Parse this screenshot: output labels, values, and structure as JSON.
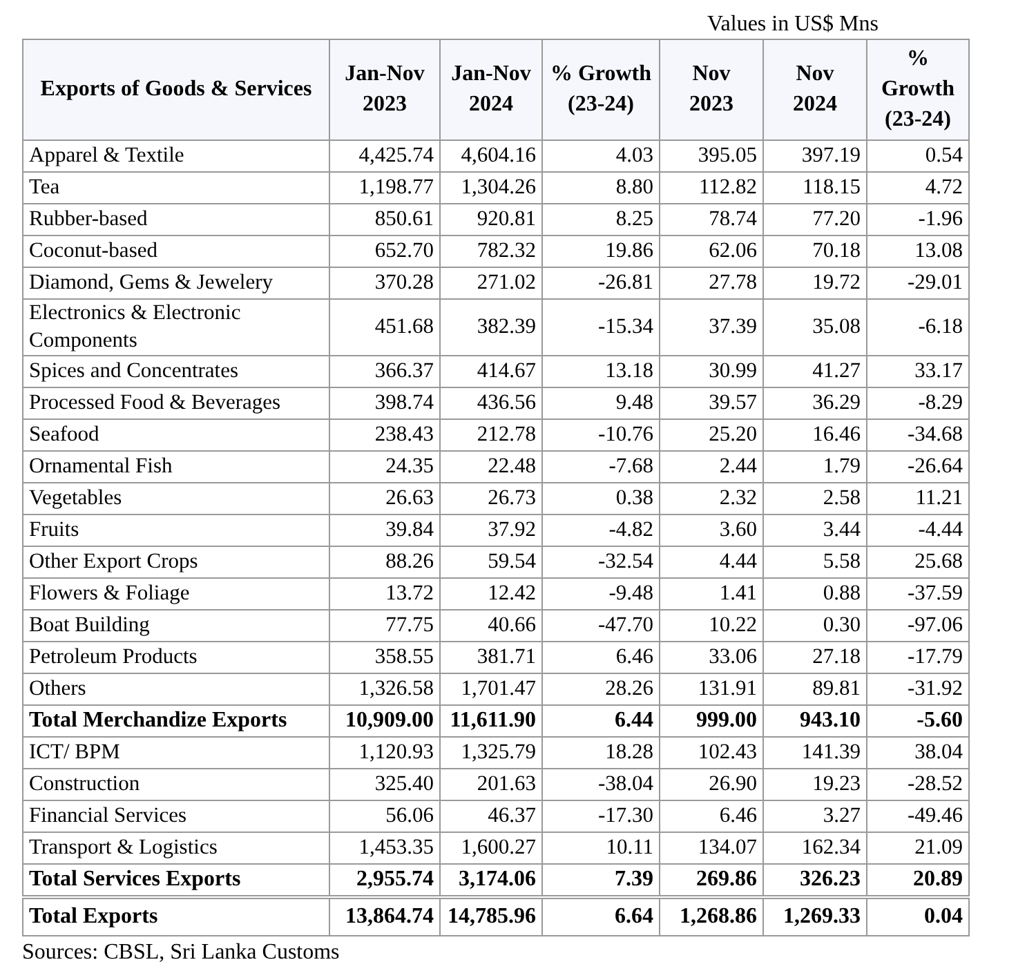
{
  "units_note": "Values in US$ Mns",
  "table": {
    "columns": [
      {
        "label": "Exports of Goods & Services"
      },
      {
        "label": "Jan-Nov\n2023"
      },
      {
        "label": "Jan-Nov\n2024"
      },
      {
        "label": "% Growth\n(23-24)"
      },
      {
        "label": "Nov\n2023"
      },
      {
        "label": "Nov\n2024"
      },
      {
        "label": "% Growth\n(23-24)"
      }
    ],
    "rows": [
      {
        "kind": "item",
        "cells": [
          "Apparel & Textile",
          "4,425.74",
          "4,604.16",
          "4.03",
          "395.05",
          "397.19",
          "0.54"
        ]
      },
      {
        "kind": "item",
        "cells": [
          "Tea",
          "1,198.77",
          "1,304.26",
          "8.80",
          "112.82",
          "118.15",
          "4.72"
        ]
      },
      {
        "kind": "item",
        "cells": [
          "Rubber-based",
          "850.61",
          "920.81",
          "8.25",
          "78.74",
          "77.20",
          "-1.96"
        ]
      },
      {
        "kind": "item",
        "cells": [
          "Coconut-based",
          "652.70",
          "782.32",
          "19.86",
          "62.06",
          "70.18",
          "13.08"
        ]
      },
      {
        "kind": "item",
        "cells": [
          "Diamond, Gems & Jewelery",
          "370.28",
          "271.02",
          "-26.81",
          "27.78",
          "19.72",
          "-29.01"
        ]
      },
      {
        "kind": "item",
        "cells": [
          "Electronics & Electronic Components",
          "451.68",
          "382.39",
          "-15.34",
          "37.39",
          "35.08",
          "-6.18"
        ]
      },
      {
        "kind": "item",
        "cells": [
          "Spices and Concentrates",
          "366.37",
          "414.67",
          "13.18",
          "30.99",
          "41.27",
          "33.17"
        ]
      },
      {
        "kind": "item",
        "cells": [
          "Processed Food & Beverages",
          "398.74",
          "436.56",
          "9.48",
          "39.57",
          "36.29",
          "-8.29"
        ]
      },
      {
        "kind": "item",
        "cells": [
          "Seafood",
          "238.43",
          "212.78",
          "-10.76",
          "25.20",
          "16.46",
          "-34.68"
        ]
      },
      {
        "kind": "item",
        "cells": [
          "Ornamental Fish",
          "24.35",
          "22.48",
          "-7.68",
          "2.44",
          "1.79",
          "-26.64"
        ]
      },
      {
        "kind": "item",
        "cells": [
          "Vegetables",
          "26.63",
          "26.73",
          "0.38",
          "2.32",
          "2.58",
          "11.21"
        ]
      },
      {
        "kind": "item",
        "cells": [
          "Fruits",
          "39.84",
          "37.92",
          "-4.82",
          "3.60",
          "3.44",
          "-4.44"
        ]
      },
      {
        "kind": "item",
        "cells": [
          "Other Export Crops",
          "88.26",
          "59.54",
          "-32.54",
          "4.44",
          "5.58",
          "25.68"
        ]
      },
      {
        "kind": "item",
        "cells": [
          "Flowers & Foliage",
          "13.72",
          "12.42",
          "-9.48",
          "1.41",
          "0.88",
          "-37.59"
        ]
      },
      {
        "kind": "item",
        "cells": [
          "Boat Building",
          "77.75",
          "40.66",
          "-47.70",
          "10.22",
          "0.30",
          "-97.06"
        ]
      },
      {
        "kind": "item",
        "cells": [
          "Petroleum Products",
          "358.55",
          "381.71",
          "6.46",
          "33.06",
          "27.18",
          "-17.79"
        ]
      },
      {
        "kind": "item",
        "cells": [
          "Others",
          "1,326.58",
          "1,701.47",
          "28.26",
          "131.91",
          "89.81",
          "-31.92"
        ]
      },
      {
        "kind": "total",
        "cells": [
          "Total Merchandize Exports",
          "10,909.00",
          "11,611.90",
          "6.44",
          "999.00",
          "943.10",
          "-5.60"
        ]
      },
      {
        "kind": "item",
        "cells": [
          "ICT/ BPM",
          "1,120.93",
          "1,325.79",
          "18.28",
          "102.43",
          "141.39",
          "38.04"
        ]
      },
      {
        "kind": "item",
        "cells": [
          "Construction",
          "325.40",
          "201.63",
          "-38.04",
          "26.90",
          "19.23",
          "-28.52"
        ]
      },
      {
        "kind": "item",
        "cells": [
          "Financial Services",
          "56.06",
          "46.37",
          "-17.30",
          "6.46",
          "3.27",
          "-49.46"
        ]
      },
      {
        "kind": "item",
        "cells": [
          "Transport & Logistics",
          "1,453.35",
          "1,600.27",
          "10.11",
          "134.07",
          "162.34",
          "21.09"
        ]
      },
      {
        "kind": "total",
        "cells": [
          "Total Services Exports",
          "2,955.74",
          "3,174.06",
          "7.39",
          "269.86",
          "326.23",
          "20.89"
        ]
      },
      {
        "kind": "grand_total",
        "cells": [
          "Total Exports",
          "13,864.74",
          "14,785.96",
          "6.64",
          "1,268.86",
          "1,269.33",
          "0.04"
        ]
      }
    ]
  },
  "source_note": "Sources: CBSL, Sri Lanka Customs"
}
